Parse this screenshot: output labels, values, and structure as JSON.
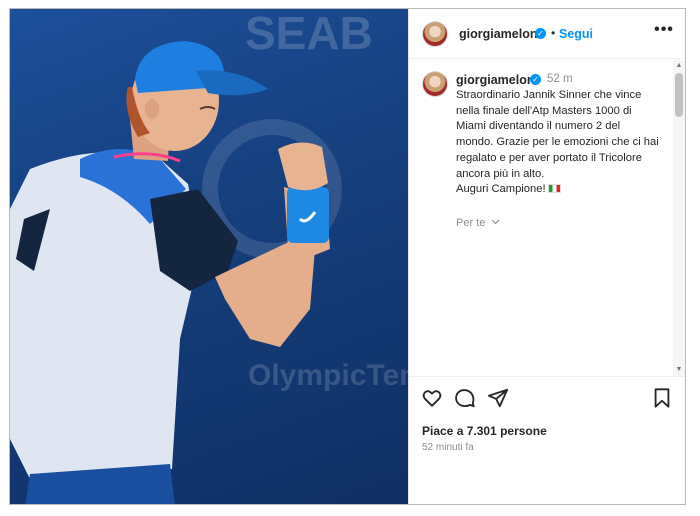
{
  "post": {
    "image_alt": "Jannik Sinner",
    "background_text": [
      "SEAB",
      "OlympicTen"
    ]
  },
  "header": {
    "username": "giorgiameloni",
    "verified_mark": "✓",
    "separator": "•",
    "follow_label": "Segui",
    "more_label": "•••"
  },
  "caption": {
    "username": "giorgiameloni",
    "time": "52 m",
    "lines": [
      "Straordinario Jannik Sinner che vince",
      "nella finale dell'Atp Masters 1000 di",
      "Miami diventando il numero 2 del",
      "mondo. Grazie per le emozioni che ci hai",
      "regalato e per aver portato il Tricolore",
      "ancora più in alto.",
      "Auguri Campione!"
    ],
    "translate_label": "Per te"
  },
  "actions": {
    "likes_text": "Piace a 7.301 persone",
    "posted_text": "52 minuti fa",
    "icons": [
      "heart-icon",
      "comment-icon",
      "share-icon",
      "bookmark-icon"
    ]
  },
  "colors": {
    "accent": "#0095f6",
    "text": "#262626",
    "muted": "#8e8e8e",
    "cap_blue": "#1f7fe0",
    "wristband": "#1e88e5"
  }
}
